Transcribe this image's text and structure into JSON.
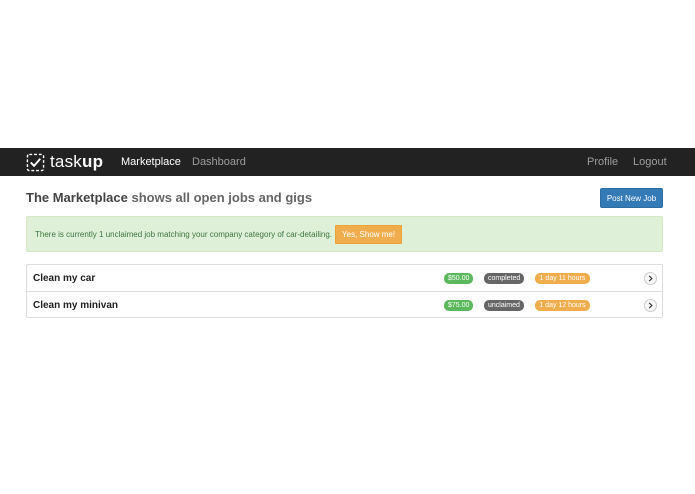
{
  "navbar": {
    "brand_light": "task",
    "brand_bold": "up",
    "brand_icon": "checkbox-icon",
    "links_left": [
      "Marketplace",
      "Dashboard"
    ],
    "links_right": [
      "Profile",
      "Logout"
    ],
    "active": "Marketplace"
  },
  "header": {
    "title_strong": "The Marketplace",
    "title_rest": " shows all open jobs and gigs",
    "post_button": "Post New Job"
  },
  "alert": {
    "text": "There is currently 1 unclaimed job matching your company category of car-detailing.",
    "button": "Yes, Show me!"
  },
  "jobs": [
    {
      "title": "Clean my car",
      "price": "$50.00",
      "status": "completed",
      "time": "1 day 11 hours"
    },
    {
      "title": "Clean my minivan",
      "price": "$75.00",
      "status": "unclaimed",
      "time": "1 day 12 hours"
    }
  ],
  "colors": {
    "navbar": "#222222",
    "primary": "#337ab7",
    "success": "#5cb85c",
    "warning": "#f0ad4e",
    "alert_bg": "#dff0d8",
    "alert_text": "#3c763d"
  }
}
